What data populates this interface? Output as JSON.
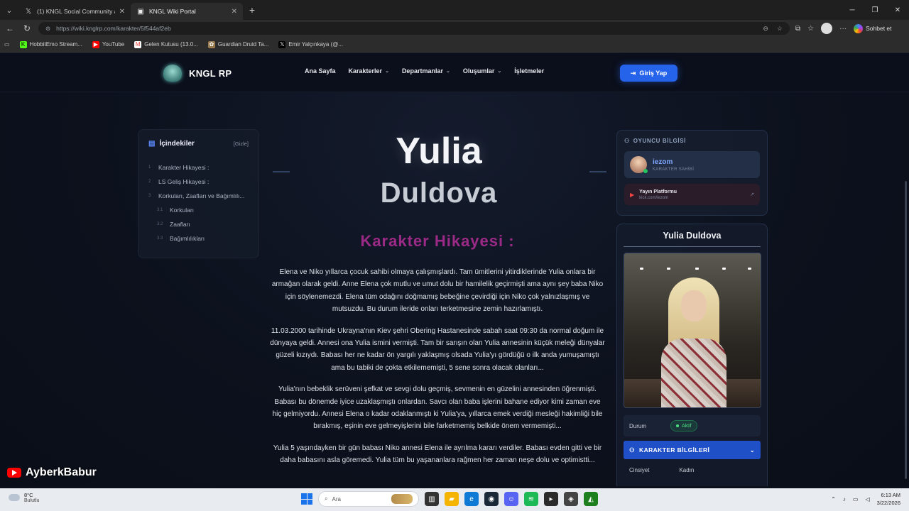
{
  "browser": {
    "tabs": [
      {
        "title": "(1) KNGL Social Community / X",
        "icon": "x-logo-icon",
        "active": false
      },
      {
        "title": "KNGL Wiki Portal",
        "icon": "page-icon",
        "active": true
      }
    ],
    "url": "https://wiki.knglrp.com/karakter/5f544af2eb",
    "chat_label": "Sohbet et",
    "bookmarks": [
      {
        "label": "HobbitEmo Stream...",
        "icon": "kick-icon",
        "color": "#53fc18"
      },
      {
        "label": "YouTube",
        "icon": "youtube-icon",
        "color": "#ff0000"
      },
      {
        "label": "Gelen Kutusu (13.0...",
        "icon": "gmail-icon",
        "color": "#ea4335"
      },
      {
        "label": "Guardian Druid Ta...",
        "icon": "paw-icon",
        "color": "#9a7b4f"
      },
      {
        "label": "Emir Yalçınkaya (@...",
        "icon": "x-logo-icon",
        "color": "#000000"
      }
    ]
  },
  "site": {
    "brand": "KNGL RP",
    "menu": [
      {
        "label": "Ana Sayfa",
        "dropdown": false
      },
      {
        "label": "Karakterler",
        "dropdown": true
      },
      {
        "label": "Departmanlar",
        "dropdown": true
      },
      {
        "label": "Oluşumlar",
        "dropdown": true
      },
      {
        "label": "İşletmeler",
        "dropdown": false
      }
    ],
    "login_label": "Giriş Yap",
    "accent": "#2563eb"
  },
  "toc": {
    "title": "İçindekiler",
    "hide_label": "[Gizle]",
    "items": [
      {
        "num": "1",
        "label": "Karakter Hikayesi :",
        "sub": false
      },
      {
        "num": "2",
        "label": "LS Geliş Hikayesi :",
        "sub": false
      },
      {
        "num": "3",
        "label": "Korkuları, Zaafları ve Bağımlılı...",
        "sub": false
      },
      {
        "num": "3.1",
        "label": "Korkuları",
        "sub": true
      },
      {
        "num": "3.2",
        "label": "Zaafları",
        "sub": true
      },
      {
        "num": "3.3",
        "label": "Bağımlılıkları",
        "sub": true
      }
    ]
  },
  "article": {
    "first_name": "Yulia",
    "last_name": "Duldova",
    "section_heading": "Karakter Hikayesi :",
    "paragraphs": [
      "Elena ve Niko yıllarca çocuk sahibi olmaya çalışmışlardı. Tam ümitlerini yitirdiklerinde Yulia onlara bir armağan olarak geldi. Anne Elena çok mutlu ve umut dolu bir hamilelik geçirmişti ama aynı şey baba Niko için söylenemezdi. Elena tüm odağını doğmamış bebeğine çevirdiği için Niko çok yalnızlaşmış ve mutsuzdu. Bu durum ileride onları terketmesine zemin hazırlamıştı.",
      "11.03.2000 tarihinde Ukrayna'nın Kiev şehri Obering Hastanesinde sabah saat 09:30 da normal doğum ile dünyaya geldi. Annesi ona Yulia ismini vermişti. Tam bir sarışın olan Yulia annesinin küçük meleği dünyalar güzeli kızıydı. Babası her ne kadar ön yargılı yaklaşmış olsada Yulia'yı gördüğü o ilk anda yumuşamıştı ama bu tabiki de çokta etkilememişti, 5 sene sonra olacak olanları...",
      "Yulia'nın bebeklik serüveni şefkat ve sevgi dolu geçmiş, sevmenin en güzelini annesinden öğrenmişti. Babası bu dönemde iyice uzaklaşmıştı onlardan. Savcı olan baba işlerini bahane ediyor kimi zaman eve hiç gelmiyordu. Annesi Elena o kadar odaklanmıştı ki Yulia'ya, yıllarca emek verdiği mesleği hakimliği bile bırakmış, eşinin eve gelmeyişlerini bile farketmemiş belkide önem vermemişti...",
      "Yulia 5 yaşındayken bir gün babası Niko annesi Elena ile ayrılma kararı verdiler. Babası evden gitti ve bir daha babasını asla göremedi. Yulia tüm bu yaşananlara rağmen her zaman neşe dolu ve optimistti..."
    ]
  },
  "player_info": {
    "label": "OYUNCU BİLGİSİ",
    "name": "iezom",
    "role": "KARAKTER SAHİBİ",
    "stream_title": "Yayın Platformu",
    "stream_sub": "kick.com/iezom"
  },
  "infobox": {
    "title": "Yulia Duldova",
    "status_label": "Durum",
    "status_value": "Aktif",
    "section_label": "KARAKTER BİLGİLERİ",
    "gender_label": "Cinsiyet",
    "gender_value": "Kadın"
  },
  "watermark": "AyberkBabur",
  "taskbar": {
    "temp": "8°C",
    "weather": "Bulutlu",
    "search_placeholder": "Ara",
    "time": "6:13 AM",
    "date": "3/22/2026"
  }
}
